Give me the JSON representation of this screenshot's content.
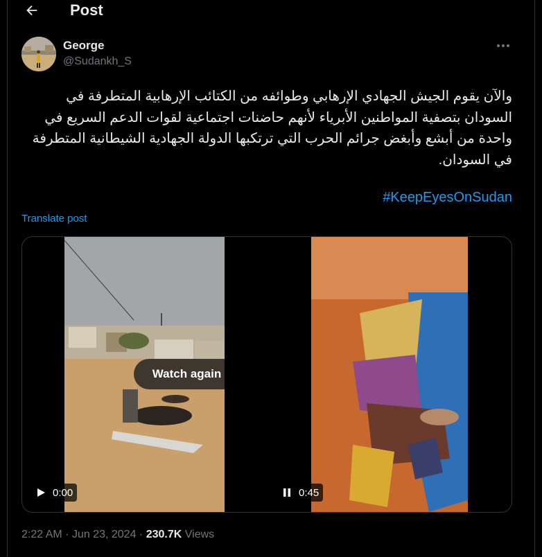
{
  "header": {
    "title": "Post"
  },
  "author": {
    "name": "George",
    "handle": "@Sudankh_S"
  },
  "post": {
    "text": "والآن يقوم الجيش الجهادي الإرهابي وطوائفه من الكتائب الإرهابية المتطرفة في السودان بتصفية المواطنين الأبرياء لأنهم حاضنات اجتماعية لقوات الدعم السريع في واحدة من أبشع وأبغض جرائم الحرب التي ترتكبها الدولة الجهادية الشيطانية المتطرفة في السودان.",
    "hashtag": "#KeepEyesOnSudan",
    "translate_label": "Translate post"
  },
  "media": {
    "left_video": {
      "overlay_label": "Watch again",
      "time": "0:00",
      "control_icon": "play-icon"
    },
    "right_video": {
      "time": "0:45",
      "control_icon": "pause-icon"
    }
  },
  "meta": {
    "time": "2:22 AM",
    "date": "Jun 23, 2024",
    "separator": "·",
    "views_count": "230.7K",
    "views_label": "Views"
  },
  "colors": {
    "background": "#000000",
    "text": "#e7e9ea",
    "secondary": "#71767b",
    "accent": "#1d9bf0",
    "border": "#2f3336"
  }
}
